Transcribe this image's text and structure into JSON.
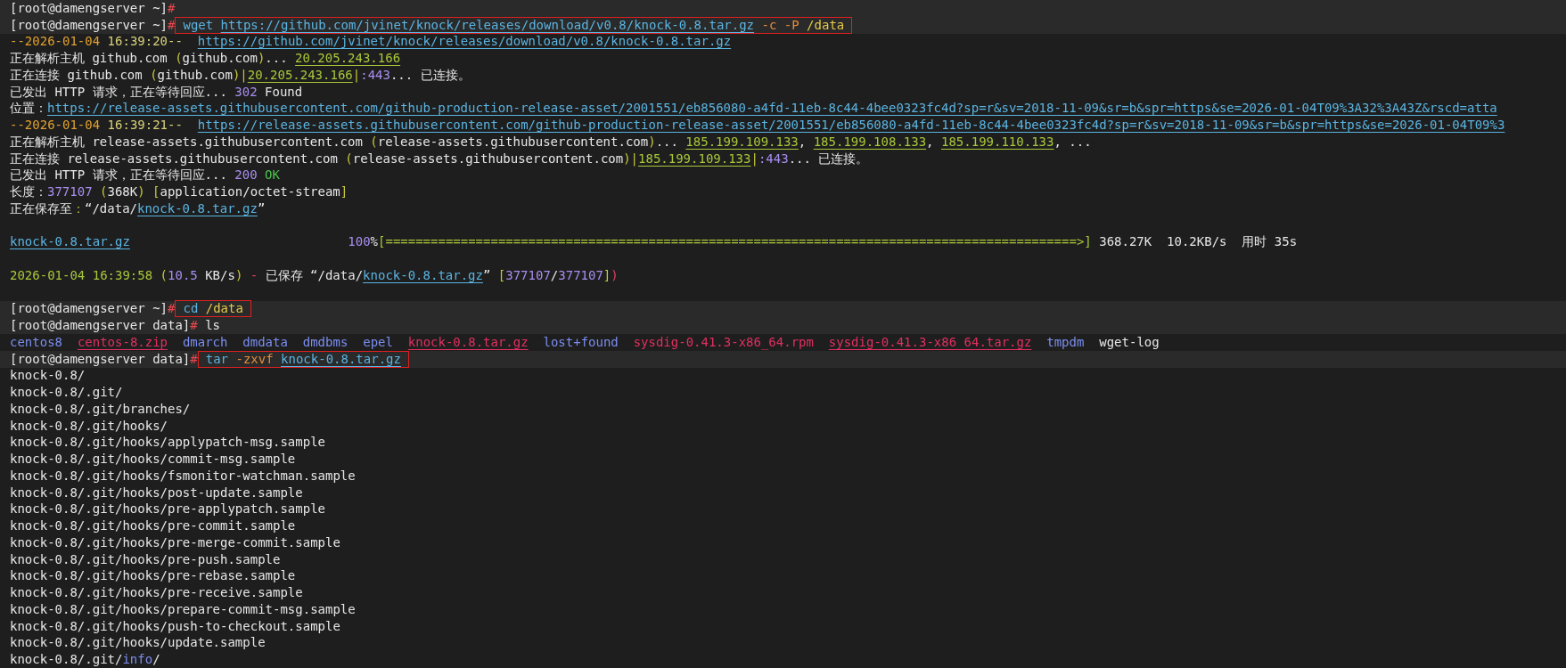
{
  "lines": [
    {
      "highlighted": true,
      "segments": [
        {
          "kind": "plain",
          "text": "[root@damengserver ~]"
        },
        {
          "kind": "hash",
          "text": "#"
        }
      ]
    },
    {
      "highlighted": true,
      "segments": [
        {
          "kind": "plain",
          "text": "[root@damengserver ~]"
        },
        {
          "kind": "hash",
          "text": "#"
        }
      ],
      "command": {
        "boxed": true,
        "segments": [
          {
            "kind": "cmd",
            "text": "wget"
          },
          {
            "kind": "link",
            "text": " https://github.com/jvinet/knock/releases/download/v0.8/knock-0.8.tar.gz"
          },
          {
            "kind": "flag",
            "text": " -c -P"
          },
          {
            "kind": "path",
            "text": " /data"
          }
        ]
      }
    },
    {
      "highlighted": false,
      "segments": [
        {
          "kind": "date",
          "text": "--2026-01-04"
        },
        {
          "kind": "time",
          "text": " 16:39:20--"
        },
        {
          "kind": "link",
          "text": "  https://github.com/jvinet/knock/releases/download/v0.8/knock-0.8.tar.gz"
        }
      ]
    },
    {
      "highlighted": false,
      "segments": [
        {
          "kind": "plain",
          "text": "正在解析主机 github.com"
        },
        {
          "kind": "punct",
          "text": " ("
        },
        {
          "kind": "plain",
          "text": "github.com"
        },
        {
          "kind": "punct",
          "text": ")"
        },
        {
          "kind": "plain",
          "text": "..."
        },
        {
          "kind": "ip",
          "text": " 20.205.243.166"
        }
      ]
    },
    {
      "highlighted": false,
      "segments": [
        {
          "kind": "plain",
          "text": "正在连接 github.com"
        },
        {
          "kind": "punct",
          "text": " ("
        },
        {
          "kind": "plain",
          "text": "github.com"
        },
        {
          "kind": "punct",
          "text": ")|"
        },
        {
          "kind": "ip",
          "text": "20.205.243.166"
        },
        {
          "kind": "punct",
          "text": "|"
        },
        {
          "kind": "number",
          "text": ":443"
        },
        {
          "kind": "plain",
          "text": "... 已连接。"
        }
      ]
    },
    {
      "highlighted": false,
      "segments": [
        {
          "kind": "plain",
          "text": "已发出 HTTP 请求，正在等待回应..."
        },
        {
          "kind": "number",
          "text": " 302"
        },
        {
          "kind": "plain",
          "text": " Found"
        }
      ]
    },
    {
      "highlighted": false,
      "segments": [
        {
          "kind": "plain",
          "text": "位置："
        },
        {
          "kind": "link",
          "text": "https://release-assets.githubusercontent.com/github-production-release-asset/2001551/eb856080-a4fd-11eb-8c44-4bee0323fc4d?sp=r&sv=2018-11-09&sr=b&spr=https&se=2026-01-04T09%3A32%3A43Z&rscd=atta"
        }
      ]
    },
    {
      "highlighted": false,
      "segments": [
        {
          "kind": "date",
          "text": "--2026-01-04"
        },
        {
          "kind": "time",
          "text": " 16:39:21--"
        },
        {
          "kind": "link",
          "text": "  https://release-assets.githubusercontent.com/github-production-release-asset/2001551/eb856080-a4fd-11eb-8c44-4bee0323fc4d?sp=r&sv=2018-11-09&sr=b&spr=https&se=2026-01-04T09%3"
        }
      ]
    },
    {
      "highlighted": false,
      "segments": [
        {
          "kind": "plain",
          "text": "正在解析主机 release-assets.githubusercontent.com"
        },
        {
          "kind": "punct",
          "text": " ("
        },
        {
          "kind": "plain",
          "text": "release-assets.githubusercontent.com"
        },
        {
          "kind": "punct",
          "text": ")"
        },
        {
          "kind": "plain",
          "text": "..."
        },
        {
          "kind": "ip",
          "text": " 185.199.109.133"
        },
        {
          "kind": "plain",
          "text": ","
        },
        {
          "kind": "ip",
          "text": " 185.199.108.133"
        },
        {
          "kind": "plain",
          "text": ","
        },
        {
          "kind": "ip",
          "text": " 185.199.110.133"
        },
        {
          "kind": "plain",
          "text": ", ..."
        }
      ]
    },
    {
      "highlighted": false,
      "segments": [
        {
          "kind": "plain",
          "text": "正在连接 release-assets.githubusercontent.com"
        },
        {
          "kind": "punct",
          "text": " ("
        },
        {
          "kind": "plain",
          "text": "release-assets.githubusercontent.com"
        },
        {
          "kind": "punct",
          "text": ")|"
        },
        {
          "kind": "ip",
          "text": "185.199.109.133"
        },
        {
          "kind": "punct",
          "text": "|"
        },
        {
          "kind": "number",
          "text": ":443"
        },
        {
          "kind": "plain",
          "text": "... 已连接。"
        }
      ]
    },
    {
      "highlighted": false,
      "segments": [
        {
          "kind": "plain",
          "text": "已发出 HTTP 请求，正在等待回应..."
        },
        {
          "kind": "number",
          "text": " 200"
        },
        {
          "kind": "ok",
          "text": " OK"
        }
      ]
    },
    {
      "highlighted": false,
      "segments": [
        {
          "kind": "plain",
          "text": "长度："
        },
        {
          "kind": "number",
          "text": "377107"
        },
        {
          "kind": "punct",
          "text": " ("
        },
        {
          "kind": "plain",
          "text": "368K"
        },
        {
          "kind": "punct",
          "text": ")"
        },
        {
          "kind": "punct",
          "text": " ["
        },
        {
          "kind": "plain",
          "text": "application/octet-stream"
        },
        {
          "kind": "punct",
          "text": "]"
        }
      ]
    },
    {
      "highlighted": false,
      "segments": [
        {
          "kind": "plain",
          "text": "正在保存至"
        },
        {
          "kind": "punct",
          "text": "："
        },
        {
          "kind": "plain",
          "text": "“/data/"
        },
        {
          "kind": "link",
          "text": "knock-0.8.tar.gz"
        },
        {
          "kind": "plain",
          "text": "”"
        }
      ]
    },
    {
      "highlighted": false
    },
    {
      "highlighted": false,
      "segments": [
        {
          "kind": "link",
          "text": "knock-0.8.tar.gz"
        },
        {
          "kind": "number",
          "text": "                             100"
        },
        {
          "kind": "plain",
          "text": "%"
        },
        {
          "kind": "bar",
          "text": "[============================================================================================>]"
        },
        {
          "kind": "plain",
          "text": " 368.27K  10.2KB/s  用时 35s"
        }
      ]
    },
    {
      "highlighted": false
    },
    {
      "highlighted": false,
      "segments": [
        {
          "kind": "success",
          "text": "2026-01-04 16:39:58"
        },
        {
          "kind": "punct",
          "text": " ("
        },
        {
          "kind": "number",
          "text": "10.5"
        },
        {
          "kind": "plain",
          "text": " KB/s"
        },
        {
          "kind": "punct",
          "text": ")"
        },
        {
          "kind": "alert",
          "text": " -"
        },
        {
          "kind": "plain",
          "text": " 已保存 “/data/"
        },
        {
          "kind": "link",
          "text": "knock-0.8.tar.gz"
        },
        {
          "kind": "plain",
          "text": "”"
        },
        {
          "kind": "punct",
          "text": " ["
        },
        {
          "kind": "number",
          "text": "377107"
        },
        {
          "kind": "plain",
          "text": "/"
        },
        {
          "kind": "number",
          "text": "377107"
        },
        {
          "kind": "punct",
          "text": "]"
        },
        {
          "kind": "alert",
          "text": ")"
        }
      ]
    },
    {
      "highlighted": false
    },
    {
      "highlighted": true,
      "segments": [
        {
          "kind": "plain",
          "text": "[root@damengserver ~]"
        },
        {
          "kind": "hash",
          "text": "#"
        }
      ],
      "command": {
        "boxed": true,
        "segments": [
          {
            "kind": "cmd",
            "text": "cd"
          },
          {
            "kind": "path",
            "text": " /data"
          }
        ]
      }
    },
    {
      "highlighted": true,
      "segments": [
        {
          "kind": "plain",
          "text": "[root@damengserver data]"
        },
        {
          "kind": "hash",
          "text": "#"
        },
        {
          "kind": "plain",
          "text": " ls"
        }
      ]
    },
    {
      "highlighted": false,
      "segments": [
        {
          "kind": "dir",
          "text": "centos8"
        },
        {
          "kind": "archive",
          "text": "  centos-8.zip"
        },
        {
          "kind": "dir",
          "text": "  dmarch"
        },
        {
          "kind": "dir",
          "text": "  dmdata"
        },
        {
          "kind": "dir",
          "text": "  dmdbms"
        },
        {
          "kind": "dir",
          "text": "  epel"
        },
        {
          "kind": "archive",
          "text": "  knock-0.8.tar.gz"
        },
        {
          "kind": "dir",
          "text": "  lost+found"
        },
        {
          "kind": "file",
          "text": "  sysdig-0.41.3-x86_64.rpm"
        },
        {
          "kind": "archive",
          "text": "  sysdig-0.41.3-x86_64.tar.gz"
        },
        {
          "kind": "dir",
          "text": "  tmpdm"
        },
        {
          "kind": "plain",
          "text": "  wget-log"
        }
      ]
    },
    {
      "highlighted": true,
      "segments": [
        {
          "kind": "plain",
          "text": "[root@damengserver data]"
        },
        {
          "kind": "hash",
          "text": "#"
        }
      ],
      "command": {
        "boxed": true,
        "segments": [
          {
            "kind": "cmd",
            "text": "tar"
          },
          {
            "kind": "flag",
            "text": " -zxvf"
          },
          {
            "kind": "link",
            "text": " knock-0.8.tar.gz"
          }
        ]
      }
    },
    {
      "highlighted": false,
      "segments": [
        {
          "kind": "plain",
          "text": "knock-0.8/"
        }
      ]
    },
    {
      "highlighted": false,
      "segments": [
        {
          "kind": "plain",
          "text": "knock-0.8/.git/"
        }
      ]
    },
    {
      "highlighted": false,
      "segments": [
        {
          "kind": "plain",
          "text": "knock-0.8/.git/branches/"
        }
      ]
    },
    {
      "highlighted": false,
      "segments": [
        {
          "kind": "plain",
          "text": "knock-0.8/.git/hooks/"
        }
      ]
    },
    {
      "highlighted": false,
      "segments": [
        {
          "kind": "plain",
          "text": "knock-0.8/.git/hooks/applypatch-msg.sample"
        }
      ]
    },
    {
      "highlighted": false,
      "segments": [
        {
          "kind": "plain",
          "text": "knock-0.8/.git/hooks/commit-msg.sample"
        }
      ]
    },
    {
      "highlighted": false,
      "segments": [
        {
          "kind": "plain",
          "text": "knock-0.8/.git/hooks/fsmonitor-watchman.sample"
        }
      ]
    },
    {
      "highlighted": false,
      "segments": [
        {
          "kind": "plain",
          "text": "knock-0.8/.git/hooks/post-update.sample"
        }
      ]
    },
    {
      "highlighted": false,
      "segments": [
        {
          "kind": "plain",
          "text": "knock-0.8/.git/hooks/pre-applypatch.sample"
        }
      ]
    },
    {
      "highlighted": false,
      "segments": [
        {
          "kind": "plain",
          "text": "knock-0.8/.git/hooks/pre-commit.sample"
        }
      ]
    },
    {
      "highlighted": false,
      "segments": [
        {
          "kind": "plain",
          "text": "knock-0.8/.git/hooks/pre-merge-commit.sample"
        }
      ]
    },
    {
      "highlighted": false,
      "segments": [
        {
          "kind": "plain",
          "text": "knock-0.8/.git/hooks/pre-push.sample"
        }
      ]
    },
    {
      "highlighted": false,
      "segments": [
        {
          "kind": "plain",
          "text": "knock-0.8/.git/hooks/pre-rebase.sample"
        }
      ]
    },
    {
      "highlighted": false,
      "segments": [
        {
          "kind": "plain",
          "text": "knock-0.8/.git/hooks/pre-receive.sample"
        }
      ]
    },
    {
      "highlighted": false,
      "segments": [
        {
          "kind": "plain",
          "text": "knock-0.8/.git/hooks/prepare-commit-msg.sample"
        }
      ]
    },
    {
      "highlighted": false,
      "segments": [
        {
          "kind": "plain",
          "text": "knock-0.8/.git/hooks/push-to-checkout.sample"
        }
      ]
    },
    {
      "highlighted": false,
      "segments": [
        {
          "kind": "plain",
          "text": "knock-0.8/.git/hooks/update.sample"
        }
      ]
    },
    {
      "highlighted": false,
      "segments": [
        {
          "kind": "plain",
          "text": "knock-0.8/.git/"
        },
        {
          "kind": "dir",
          "text": "info"
        },
        {
          "kind": "plain",
          "text": "/"
        }
      ]
    }
  ]
}
